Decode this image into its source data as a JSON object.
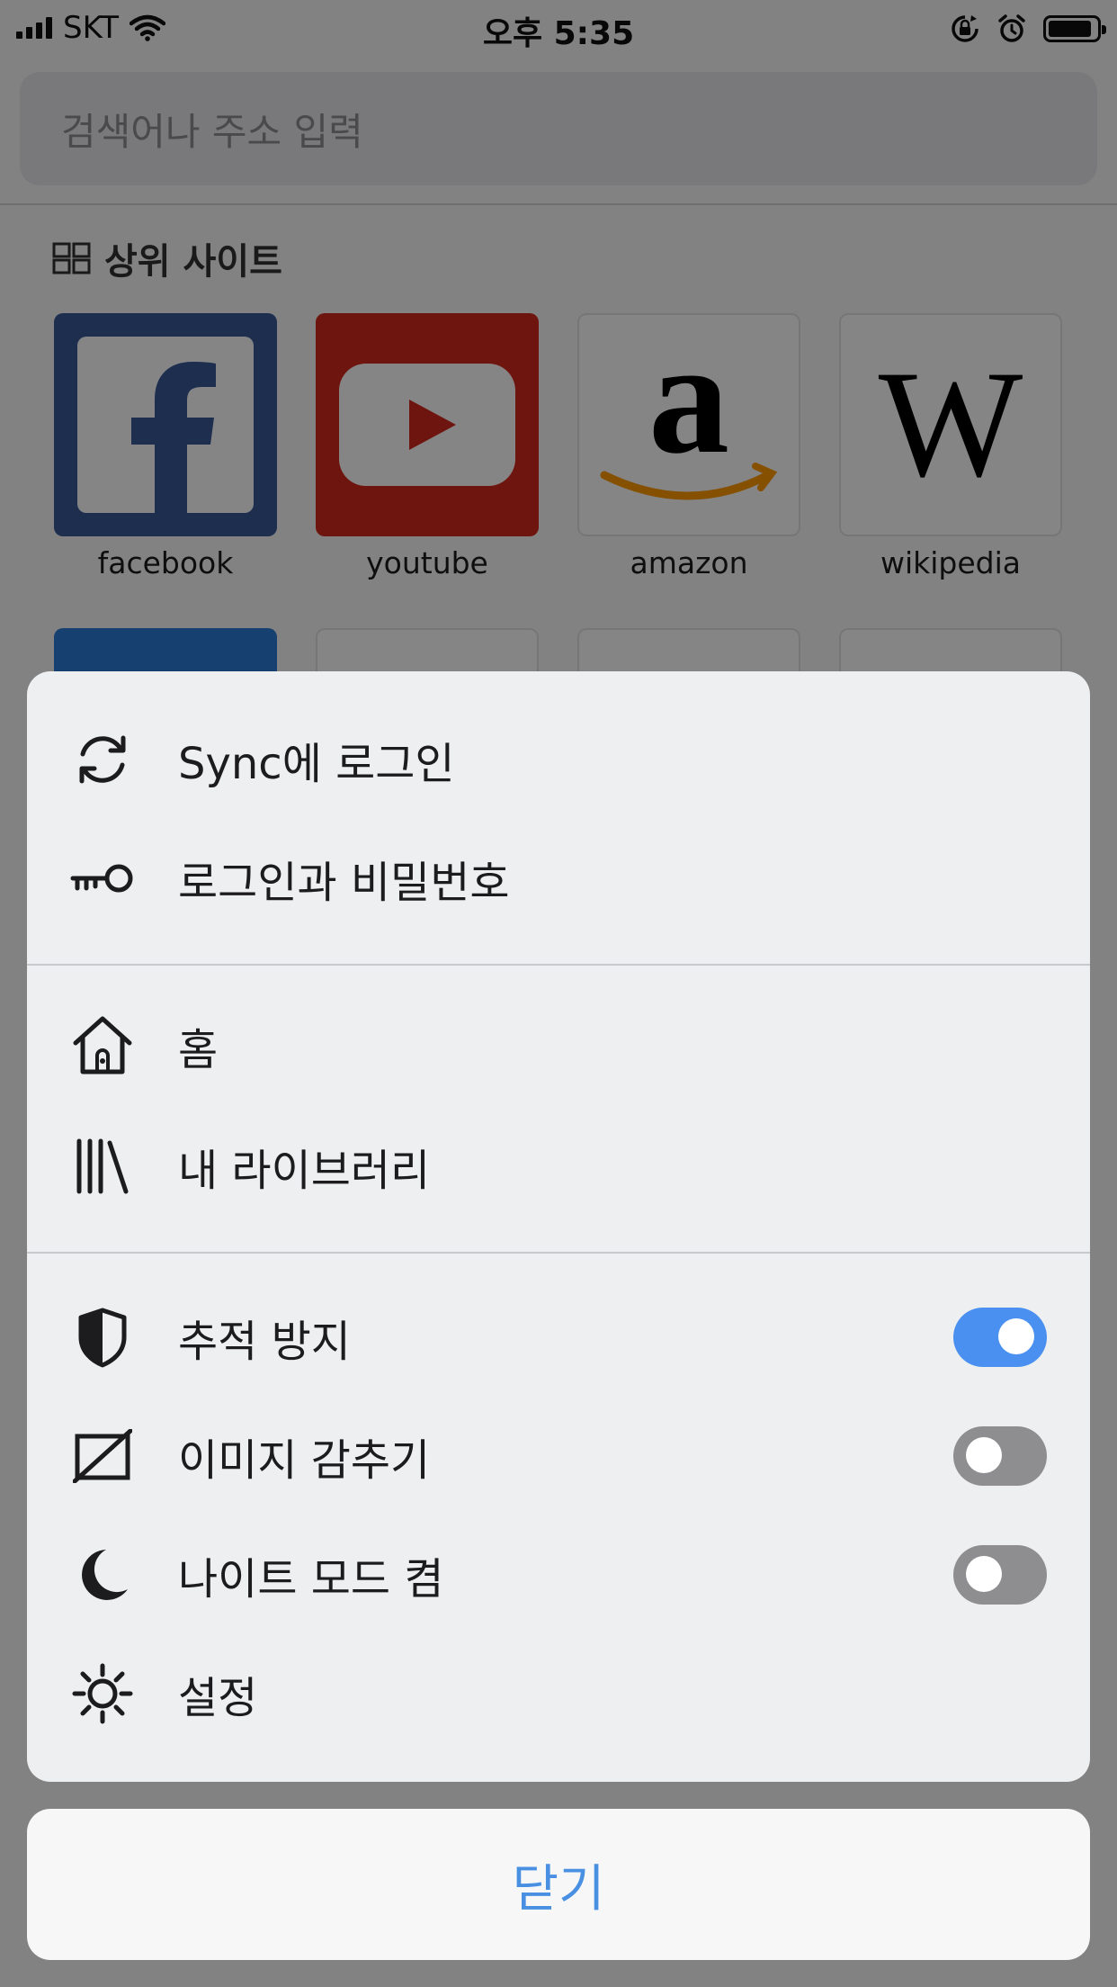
{
  "status_bar": {
    "carrier": "SKT",
    "time": "오후 5:35",
    "icons": [
      "signal-bars-icon",
      "wifi-icon",
      "orientation-lock-icon",
      "alarm-icon",
      "battery-icon"
    ]
  },
  "search": {
    "placeholder": "검색어나 주소 입력"
  },
  "top_sites": {
    "title": "상위 사이트",
    "title_icon": "grid-icon",
    "sites": [
      {
        "label": "facebook",
        "icon": "facebook-icon",
        "color": "#3b5998"
      },
      {
        "label": "youtube",
        "icon": "youtube-icon",
        "color": "#e62117"
      },
      {
        "label": "amazon",
        "icon": "amazon-icon",
        "color": "#ff9900"
      },
      {
        "label": "wikipedia",
        "icon": "wikipedia-icon",
        "color": "#000000"
      }
    ]
  },
  "menu": {
    "sections": [
      [
        {
          "label": "Sync에 로그인",
          "icon": "sync-icon"
        },
        {
          "label": "로그인과 비밀번호",
          "icon": "key-icon"
        }
      ],
      [
        {
          "label": "홈",
          "icon": "home-icon"
        },
        {
          "label": "내 라이브러리",
          "icon": "library-icon"
        }
      ],
      [
        {
          "label": "추적 방지",
          "icon": "shield-icon",
          "toggle": true
        },
        {
          "label": "이미지 감추기",
          "icon": "hide-image-icon",
          "toggle": false
        },
        {
          "label": "나이트 모드 켬",
          "icon": "moon-icon",
          "toggle": false
        },
        {
          "label": "설정",
          "icon": "settings-sun-icon"
        }
      ]
    ],
    "close_label": "닫기"
  },
  "colors": {
    "accent": "#4a90f0",
    "close_text": "#4a90e2",
    "toggle_off": "#8e8e91"
  }
}
